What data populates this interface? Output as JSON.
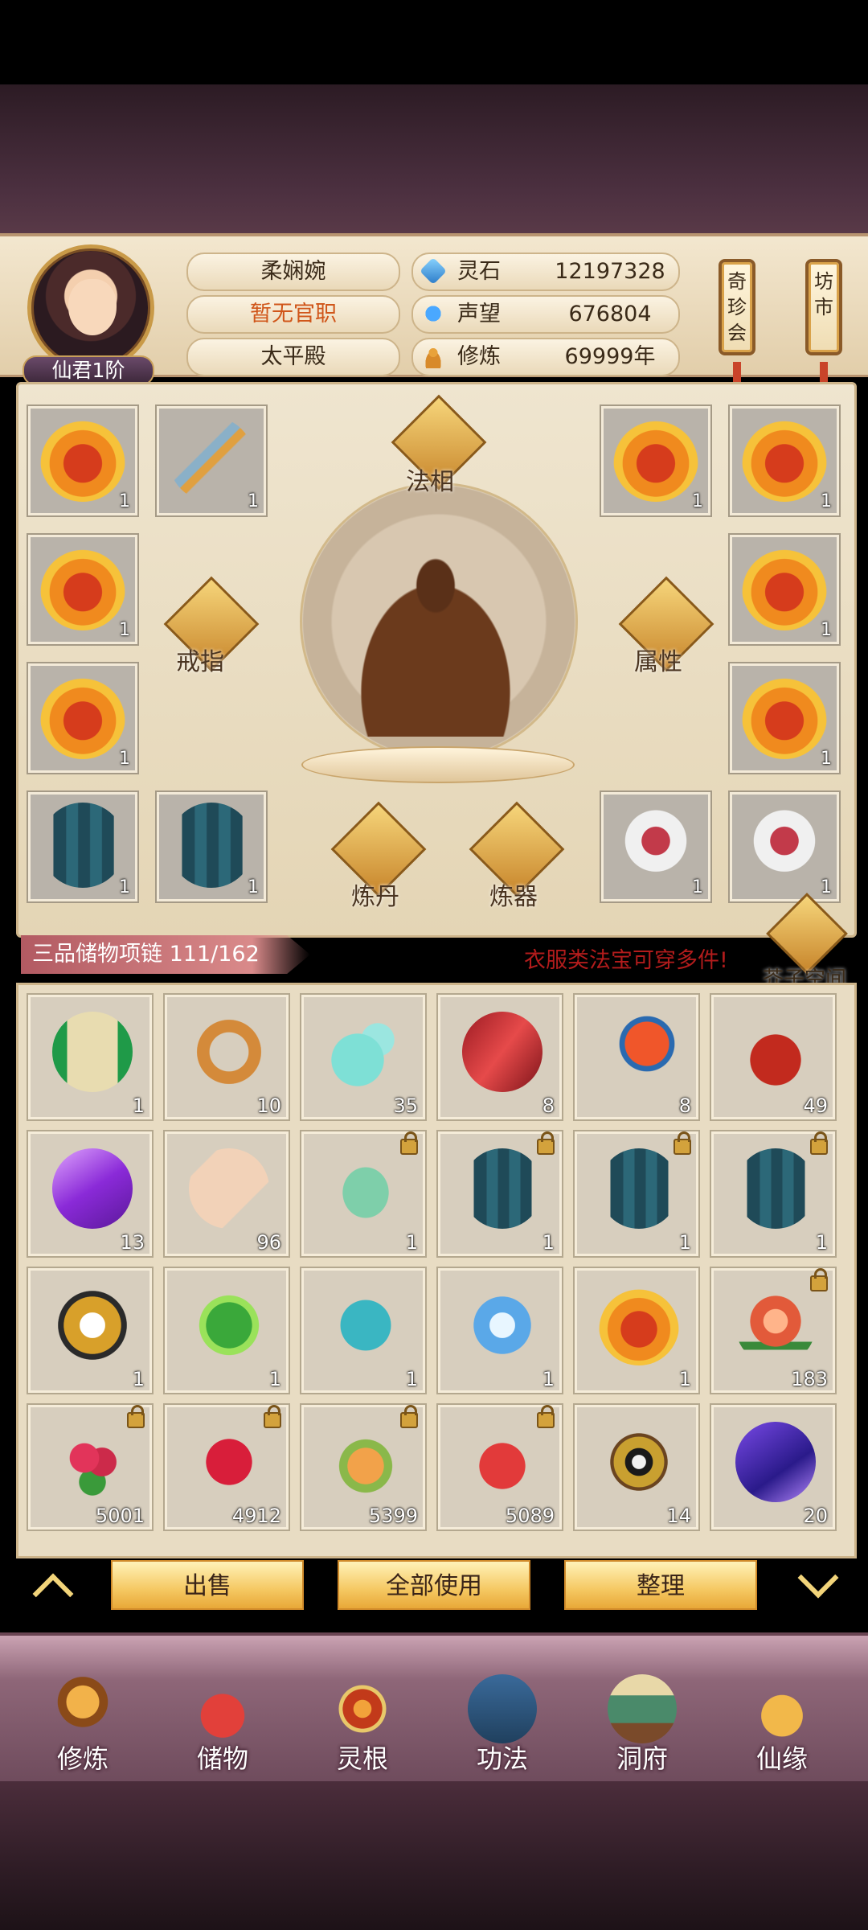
{
  "colors": {
    "accent_red": "#b21c1c",
    "gold": "#f5c862"
  },
  "player": {
    "name": "柔娴婉",
    "official_title": "暂无官职",
    "palace": "太平殿",
    "rank": "仙君1阶"
  },
  "stats": [
    {
      "label": "灵石",
      "value": "12197328",
      "icon": "spirit-stone-icon"
    },
    {
      "label": "声望",
      "value": "676804",
      "icon": "reputation-icon"
    },
    {
      "label": "修炼",
      "value": "69999年",
      "icon": "cultivation-icon"
    }
  ],
  "side_signs": {
    "treasure_auction": "奇珍会",
    "market": "坊市"
  },
  "equipment": {
    "slots_left": [
      {
        "item": "fire-robe-icon",
        "count": "1"
      },
      {
        "item": "sword-icon",
        "count": "1"
      },
      {
        "item": "fire-robe-icon",
        "count": "1"
      },
      {
        "item": "fire-robe-icon",
        "count": "1"
      },
      {
        "item": "blue-robe-icon",
        "count": "1"
      },
      {
        "item": "blue-robe-icon",
        "count": "1"
      }
    ],
    "slots_right": [
      {
        "item": "fire-robe-icon",
        "count": "1"
      },
      {
        "item": "fire-robe-icon",
        "count": "1"
      },
      {
        "item": "fire-robe-icon",
        "count": "1"
      },
      {
        "item": "fire-robe-icon",
        "count": "1"
      },
      {
        "item": "red-white-robe-icon",
        "count": "1"
      },
      {
        "item": "red-white-robe-icon",
        "count": "1"
      }
    ],
    "buttons": {
      "faxiang": "法相",
      "ring": "戒指",
      "attributes": "属性",
      "alchemy": "炼丹",
      "forging": "炼器"
    }
  },
  "bag": {
    "title": "三品储物项链 111/162",
    "hint": "衣服类法宝可穿多件!",
    "space_button": "芥子空间",
    "items": [
      {
        "icon": "scroll-icon",
        "count": "1",
        "locked": false
      },
      {
        "icon": "ring-icon",
        "count": "10",
        "locked": false
      },
      {
        "icon": "gourd-icon",
        "count": "35",
        "locked": false
      },
      {
        "icon": "red-crystal-icon",
        "count": "8",
        "locked": false
      },
      {
        "icon": "feather-icon",
        "count": "8",
        "locked": false
      },
      {
        "icon": "teapot-icon",
        "count": "49",
        "locked": false
      },
      {
        "icon": "purple-crystal-icon",
        "count": "13",
        "locked": false
      },
      {
        "icon": "paper-scroll-icon",
        "count": "96",
        "locked": false
      },
      {
        "icon": "green-robe-icon",
        "count": "1",
        "locked": true
      },
      {
        "icon": "blue-robe-icon",
        "count": "1",
        "locked": true
      },
      {
        "icon": "blue-robe-icon",
        "count": "1",
        "locked": true
      },
      {
        "icon": "blue-robe-icon",
        "count": "1",
        "locked": true
      },
      {
        "icon": "yinyang-robe-icon",
        "count": "1",
        "locked": false
      },
      {
        "icon": "green-armor-icon",
        "count": "1",
        "locked": false
      },
      {
        "icon": "teal-robe-icon",
        "count": "1",
        "locked": false
      },
      {
        "icon": "ice-robe-icon",
        "count": "1",
        "locked": false
      },
      {
        "icon": "fire-robe-icon",
        "count": "1",
        "locked": false
      },
      {
        "icon": "peach-icon",
        "count": "183",
        "locked": true
      },
      {
        "icon": "berries-icon",
        "count": "5001",
        "locked": true
      },
      {
        "icon": "raspberry-icon",
        "count": "4912",
        "locked": true
      },
      {
        "icon": "artichoke-icon",
        "count": "5399",
        "locked": true
      },
      {
        "icon": "pomegranate-icon",
        "count": "5089",
        "locked": true
      },
      {
        "icon": "bagua-icon",
        "count": "14",
        "locked": false
      },
      {
        "icon": "violet-gem-icon",
        "count": "20",
        "locked": false
      }
    ]
  },
  "actions": {
    "sell": "出售",
    "use_all": "全部使用",
    "sort": "整理"
  },
  "nav": [
    "修炼",
    "储物",
    "灵根",
    "功法",
    "洞府",
    "仙缘"
  ]
}
